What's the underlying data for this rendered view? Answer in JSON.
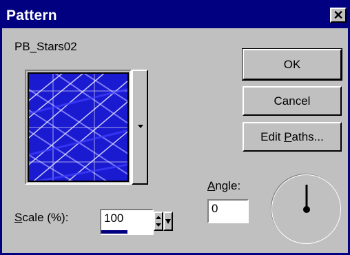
{
  "dialog": {
    "title": "Pattern",
    "close_glyph": "✕"
  },
  "pattern": {
    "name": "PB_Stars02"
  },
  "buttons": {
    "ok": "OK",
    "cancel": "Cancel",
    "edit_paths_pre": "Edit ",
    "edit_paths_mnemonic": "P",
    "edit_paths_post": "aths..."
  },
  "scale": {
    "label_mnemonic": "S",
    "label_rest": "cale (%):",
    "value": "100"
  },
  "angle": {
    "label_mnemonic": "A",
    "label_rest": "ngle:",
    "value": "0"
  },
  "icons": {
    "close": "close-icon",
    "dropdown": "chevron-down-icon",
    "spin_up": "arrow-up-icon",
    "spin_down": "arrow-down-icon"
  },
  "colors": {
    "titlebar": "#000080",
    "face": "#c0c0c0",
    "swatch_base": "#1a1ad0"
  }
}
